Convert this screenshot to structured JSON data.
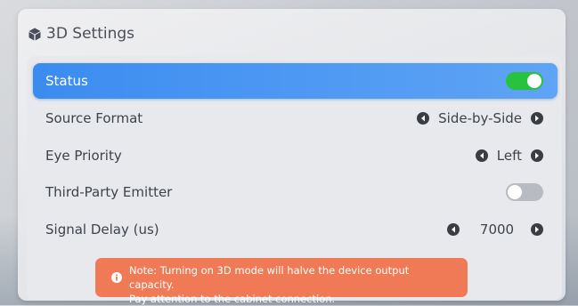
{
  "panel": {
    "title": "3D Settings",
    "title_icon": "cube-icon"
  },
  "settings": {
    "status": {
      "label": "Status",
      "enabled": true
    },
    "source_format": {
      "label": "Source Format",
      "value": "Side-by-Side"
    },
    "eye_priority": {
      "label": "Eye Priority",
      "value": "Left"
    },
    "third_party_emitter": {
      "label": "Third-Party Emitter",
      "enabled": false
    },
    "signal_delay": {
      "label": "Signal Delay (us)",
      "value": "7000"
    }
  },
  "note": {
    "line1": "Note: Turning on 3D mode will halve the device output capacity.",
    "line2": "Pay attention to the cabinet connection.",
    "icon": "info-icon"
  },
  "colors": {
    "accent_blue": "#3b8cf0",
    "toggle_on": "#27c33e",
    "toggle_off": "#b8bcc2",
    "note_bg": "#f07a55"
  }
}
